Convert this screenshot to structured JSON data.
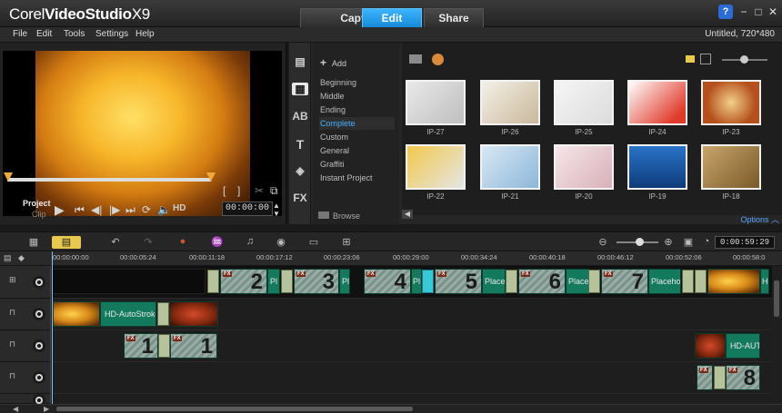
{
  "app": {
    "logo_brand": "Corel",
    "logo_product": "VideoStudio",
    "logo_version": "X9",
    "project_info": "Untitled, 720*480"
  },
  "main_tabs": [
    {
      "label": "Capture",
      "active": false
    },
    {
      "label": "Edit",
      "active": true
    },
    {
      "label": "Share",
      "active": false
    }
  ],
  "menu": [
    "File",
    "Edit",
    "Tools",
    "Settings",
    "Help"
  ],
  "preview": {
    "mode_project": "Project",
    "mode_clip": "Clip",
    "hd_label": "HD",
    "timecode": "00:00:00",
    "scrub_position": 0.0
  },
  "library": {
    "add_label": "Add",
    "browse_label": "Browse",
    "options_label": "Options",
    "categories": [
      "Beginning",
      "Middle",
      "Ending",
      "Complete",
      "Custom",
      "General",
      "Graffiti",
      "Instant Project"
    ],
    "selected_category": "Complete",
    "thumbnails": [
      {
        "label": "IP-27"
      },
      {
        "label": "IP-26"
      },
      {
        "label": "IP-25"
      },
      {
        "label": "IP-24"
      },
      {
        "label": "IP-23"
      },
      {
        "label": "IP-22"
      },
      {
        "label": "IP-21"
      },
      {
        "label": "IP-20"
      },
      {
        "label": "IP-19"
      },
      {
        "label": "IP-18"
      }
    ],
    "side_icons": [
      "media-icon",
      "instant-project-icon",
      "transition-icon",
      "title-icon",
      "graphic-icon",
      "fx-icon"
    ]
  },
  "timeline": {
    "duration": "0:00:59:29",
    "ruler": [
      "00:00:00:00",
      "00:00:05:24",
      "00:00:11:18",
      "00:00:17:12",
      "00:00:23:06",
      "00:00:29:00",
      "00:00:34:24",
      "00:00:40:18",
      "00:00:46:12",
      "00:00:52:06",
      "00:00:58:0"
    ],
    "video_track_clips": [
      {
        "num": "2",
        "text": "Pl"
      },
      {
        "num": "3",
        "text": "Pl"
      },
      {
        "num": "4",
        "text": "Pl"
      },
      {
        "num": "5",
        "text": "Place"
      },
      {
        "num": "6",
        "text": "Place"
      },
      {
        "num": "7",
        "text": "Placeholo"
      },
      {
        "num": "",
        "text": "H"
      }
    ],
    "overlay1_clip_text": "HD-AutoStroke",
    "overlay2_clips": [
      {
        "num": "1"
      },
      {
        "num": "1"
      }
    ],
    "overlay2_right_text": "HD-AUTO",
    "overlay3_clip_num": "8"
  }
}
